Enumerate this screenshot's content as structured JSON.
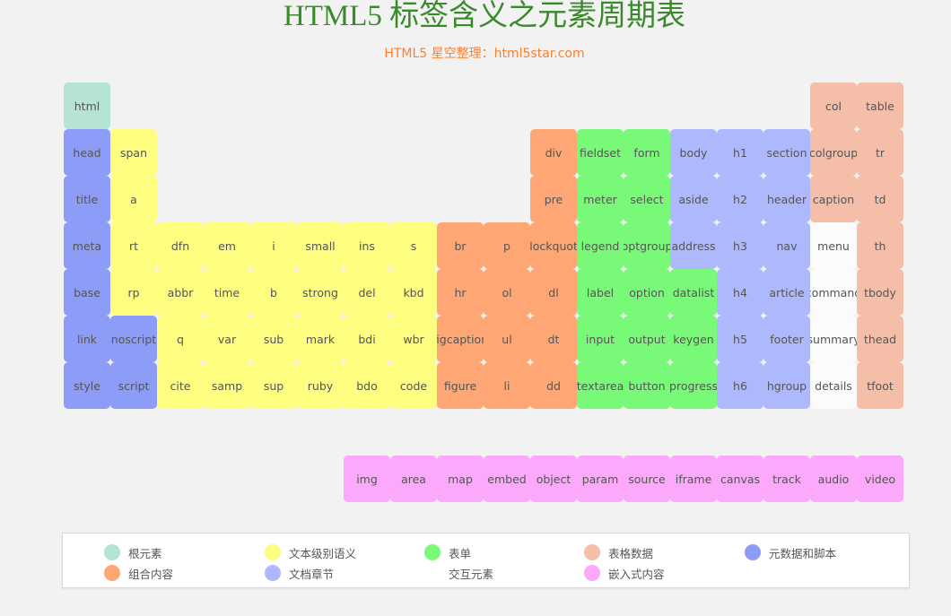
{
  "page": {
    "title": "HTML5 标签含义之元素周期表",
    "subtitle": "HTML5 星空整理：html5star.com"
  },
  "colors": {
    "root": "#b5e4d2",
    "metadata_scripting": "#8d9cf6",
    "text_semantics": "#fdfd80",
    "grouping": "#fea774",
    "forms": "#79f978",
    "sections": "#aeb8fc",
    "interactive": "#fbfbfb",
    "tabular": "#f4bea9",
    "embedded": "#fca8fb"
  },
  "elements": [
    {
      "tag": "html",
      "row": 0,
      "col": 0,
      "cat": "root"
    },
    {
      "tag": "col",
      "row": 0,
      "col": 16,
      "cat": "table"
    },
    {
      "tag": "table",
      "row": 0,
      "col": 17,
      "cat": "table"
    },
    {
      "tag": "head",
      "row": 1,
      "col": 0,
      "cat": "meta"
    },
    {
      "tag": "span",
      "row": 1,
      "col": 1,
      "cat": "text"
    },
    {
      "tag": "div",
      "row": 1,
      "col": 10,
      "cat": "group"
    },
    {
      "tag": "fieldset",
      "row": 1,
      "col": 11,
      "cat": "form"
    },
    {
      "tag": "form",
      "row": 1,
      "col": 12,
      "cat": "form"
    },
    {
      "tag": "body",
      "row": 1,
      "col": 13,
      "cat": "section"
    },
    {
      "tag": "h1",
      "row": 1,
      "col": 14,
      "cat": "section"
    },
    {
      "tag": "section",
      "row": 1,
      "col": 15,
      "cat": "section"
    },
    {
      "tag": "colgroup",
      "row": 1,
      "col": 16,
      "cat": "table"
    },
    {
      "tag": "tr",
      "row": 1,
      "col": 17,
      "cat": "table"
    },
    {
      "tag": "title",
      "row": 2,
      "col": 0,
      "cat": "meta"
    },
    {
      "tag": "a",
      "row": 2,
      "col": 1,
      "cat": "text"
    },
    {
      "tag": "pre",
      "row": 2,
      "col": 10,
      "cat": "group"
    },
    {
      "tag": "meter",
      "row": 2,
      "col": 11,
      "cat": "form"
    },
    {
      "tag": "select",
      "row": 2,
      "col": 12,
      "cat": "form"
    },
    {
      "tag": "aside",
      "row": 2,
      "col": 13,
      "cat": "section"
    },
    {
      "tag": "h2",
      "row": 2,
      "col": 14,
      "cat": "section"
    },
    {
      "tag": "header",
      "row": 2,
      "col": 15,
      "cat": "section"
    },
    {
      "tag": "caption",
      "row": 2,
      "col": 16,
      "cat": "table"
    },
    {
      "tag": "td",
      "row": 2,
      "col": 17,
      "cat": "table"
    },
    {
      "tag": "meta",
      "row": 3,
      "col": 0,
      "cat": "meta"
    },
    {
      "tag": "rt",
      "row": 3,
      "col": 1,
      "cat": "text"
    },
    {
      "tag": "dfn",
      "row": 3,
      "col": 2,
      "cat": "text"
    },
    {
      "tag": "em",
      "row": 3,
      "col": 3,
      "cat": "text"
    },
    {
      "tag": "i",
      "row": 3,
      "col": 4,
      "cat": "text"
    },
    {
      "tag": "small",
      "row": 3,
      "col": 5,
      "cat": "text"
    },
    {
      "tag": "ins",
      "row": 3,
      "col": 6,
      "cat": "text"
    },
    {
      "tag": "s",
      "row": 3,
      "col": 7,
      "cat": "text"
    },
    {
      "tag": "br",
      "row": 3,
      "col": 8,
      "cat": "group"
    },
    {
      "tag": "p",
      "row": 3,
      "col": 9,
      "cat": "group"
    },
    {
      "tag": "blockquote",
      "row": 3,
      "col": 10,
      "cat": "group"
    },
    {
      "tag": "legend",
      "row": 3,
      "col": 11,
      "cat": "form"
    },
    {
      "tag": "optgroup",
      "row": 3,
      "col": 12,
      "cat": "form"
    },
    {
      "tag": "address",
      "row": 3,
      "col": 13,
      "cat": "section"
    },
    {
      "tag": "h3",
      "row": 3,
      "col": 14,
      "cat": "section"
    },
    {
      "tag": "nav",
      "row": 3,
      "col": 15,
      "cat": "section"
    },
    {
      "tag": "menu",
      "row": 3,
      "col": 16,
      "cat": "interactive"
    },
    {
      "tag": "th",
      "row": 3,
      "col": 17,
      "cat": "table"
    },
    {
      "tag": "base",
      "row": 4,
      "col": 0,
      "cat": "meta"
    },
    {
      "tag": "rp",
      "row": 4,
      "col": 1,
      "cat": "text"
    },
    {
      "tag": "abbr",
      "row": 4,
      "col": 2,
      "cat": "text"
    },
    {
      "tag": "time",
      "row": 4,
      "col": 3,
      "cat": "text"
    },
    {
      "tag": "b",
      "row": 4,
      "col": 4,
      "cat": "text"
    },
    {
      "tag": "strong",
      "row": 4,
      "col": 5,
      "cat": "text"
    },
    {
      "tag": "del",
      "row": 4,
      "col": 6,
      "cat": "text"
    },
    {
      "tag": "kbd",
      "row": 4,
      "col": 7,
      "cat": "text"
    },
    {
      "tag": "hr",
      "row": 4,
      "col": 8,
      "cat": "group"
    },
    {
      "tag": "ol",
      "row": 4,
      "col": 9,
      "cat": "group"
    },
    {
      "tag": "dl",
      "row": 4,
      "col": 10,
      "cat": "group"
    },
    {
      "tag": "label",
      "row": 4,
      "col": 11,
      "cat": "form"
    },
    {
      "tag": "option",
      "row": 4,
      "col": 12,
      "cat": "form"
    },
    {
      "tag": "datalist",
      "row": 4,
      "col": 13,
      "cat": "form"
    },
    {
      "tag": "h4",
      "row": 4,
      "col": 14,
      "cat": "section"
    },
    {
      "tag": "article",
      "row": 4,
      "col": 15,
      "cat": "section"
    },
    {
      "tag": "command",
      "row": 4,
      "col": 16,
      "cat": "interactive"
    },
    {
      "tag": "tbody",
      "row": 4,
      "col": 17,
      "cat": "table"
    },
    {
      "tag": "link",
      "row": 5,
      "col": 0,
      "cat": "meta"
    },
    {
      "tag": "noscript",
      "row": 5,
      "col": 1,
      "cat": "meta"
    },
    {
      "tag": "q",
      "row": 5,
      "col": 2,
      "cat": "text"
    },
    {
      "tag": "var",
      "row": 5,
      "col": 3,
      "cat": "text"
    },
    {
      "tag": "sub",
      "row": 5,
      "col": 4,
      "cat": "text"
    },
    {
      "tag": "mark",
      "row": 5,
      "col": 5,
      "cat": "text"
    },
    {
      "tag": "bdi",
      "row": 5,
      "col": 6,
      "cat": "text"
    },
    {
      "tag": "wbr",
      "row": 5,
      "col": 7,
      "cat": "text"
    },
    {
      "tag": "figcaption",
      "row": 5,
      "col": 8,
      "cat": "group"
    },
    {
      "tag": "ul",
      "row": 5,
      "col": 9,
      "cat": "group"
    },
    {
      "tag": "dt",
      "row": 5,
      "col": 10,
      "cat": "group"
    },
    {
      "tag": "input",
      "row": 5,
      "col": 11,
      "cat": "form"
    },
    {
      "tag": "output",
      "row": 5,
      "col": 12,
      "cat": "form"
    },
    {
      "tag": "keygen",
      "row": 5,
      "col": 13,
      "cat": "form"
    },
    {
      "tag": "h5",
      "row": 5,
      "col": 14,
      "cat": "section"
    },
    {
      "tag": "footer",
      "row": 5,
      "col": 15,
      "cat": "section"
    },
    {
      "tag": "summary",
      "row": 5,
      "col": 16,
      "cat": "interactive"
    },
    {
      "tag": "thead",
      "row": 5,
      "col": 17,
      "cat": "table"
    },
    {
      "tag": "style",
      "row": 6,
      "col": 0,
      "cat": "meta"
    },
    {
      "tag": "script",
      "row": 6,
      "col": 1,
      "cat": "meta"
    },
    {
      "tag": "cite",
      "row": 6,
      "col": 2,
      "cat": "text"
    },
    {
      "tag": "samp",
      "row": 6,
      "col": 3,
      "cat": "text"
    },
    {
      "tag": "sup",
      "row": 6,
      "col": 4,
      "cat": "text"
    },
    {
      "tag": "ruby",
      "row": 6,
      "col": 5,
      "cat": "text"
    },
    {
      "tag": "bdo",
      "row": 6,
      "col": 6,
      "cat": "text"
    },
    {
      "tag": "code",
      "row": 6,
      "col": 7,
      "cat": "text"
    },
    {
      "tag": "figure",
      "row": 6,
      "col": 8,
      "cat": "group"
    },
    {
      "tag": "li",
      "row": 6,
      "col": 9,
      "cat": "group"
    },
    {
      "tag": "dd",
      "row": 6,
      "col": 10,
      "cat": "group"
    },
    {
      "tag": "textarea",
      "row": 6,
      "col": 11,
      "cat": "form"
    },
    {
      "tag": "button",
      "row": 6,
      "col": 12,
      "cat": "form"
    },
    {
      "tag": "progress",
      "row": 6,
      "col": 13,
      "cat": "form"
    },
    {
      "tag": "h6",
      "row": 6,
      "col": 14,
      "cat": "section"
    },
    {
      "tag": "hgroup",
      "row": 6,
      "col": 15,
      "cat": "section"
    },
    {
      "tag": "details",
      "row": 6,
      "col": 16,
      "cat": "interactive"
    },
    {
      "tag": "tfoot",
      "row": 6,
      "col": 17,
      "cat": "table"
    },
    {
      "tag": "img",
      "row": 8,
      "col": 6,
      "cat": "embed"
    },
    {
      "tag": "area",
      "row": 8,
      "col": 7,
      "cat": "embed"
    },
    {
      "tag": "map",
      "row": 8,
      "col": 8,
      "cat": "embed"
    },
    {
      "tag": "embed",
      "row": 8,
      "col": 9,
      "cat": "embed"
    },
    {
      "tag": "object",
      "row": 8,
      "col": 10,
      "cat": "embed"
    },
    {
      "tag": "param",
      "row": 8,
      "col": 11,
      "cat": "embed"
    },
    {
      "tag": "source",
      "row": 8,
      "col": 12,
      "cat": "embed"
    },
    {
      "tag": "iframe",
      "row": 8,
      "col": 13,
      "cat": "embed"
    },
    {
      "tag": "canvas",
      "row": 8,
      "col": 14,
      "cat": "embed"
    },
    {
      "tag": "track",
      "row": 8,
      "col": 15,
      "cat": "embed"
    },
    {
      "tag": "audio",
      "row": 8,
      "col": 16,
      "cat": "embed"
    },
    {
      "tag": "video",
      "row": 8,
      "col": 17,
      "cat": "embed"
    }
  ],
  "legend": [
    {
      "label": "根元素",
      "cat": "root"
    },
    {
      "label": "文本级别语义",
      "cat": "text"
    },
    {
      "label": "表单",
      "cat": "form"
    },
    {
      "label": "表格数据",
      "cat": "table"
    },
    {
      "label": "元数据和脚本",
      "cat": "meta"
    },
    {
      "label": "组合内容",
      "cat": "group"
    },
    {
      "label": "文档章节",
      "cat": "section"
    },
    {
      "label": "交互元素",
      "cat": "interactive"
    },
    {
      "label": "嵌入式内容",
      "cat": "embed"
    }
  ]
}
